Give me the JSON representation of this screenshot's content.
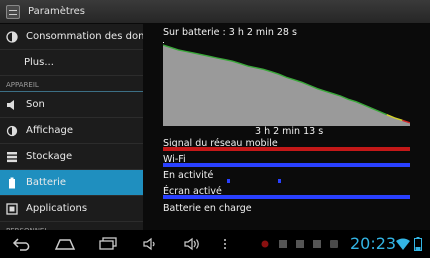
{
  "titlebar": {
    "title": "Paramètres"
  },
  "sidebar": {
    "items": [
      {
        "label": "Consommation des donné"
      },
      {
        "label": "Plus..."
      },
      {
        "section": "APPAREIL"
      },
      {
        "label": "Son"
      },
      {
        "label": "Affichage"
      },
      {
        "label": "Stockage"
      },
      {
        "label": "Batterie"
      },
      {
        "label": "Applications"
      },
      {
        "section": "PERSONNEL"
      }
    ]
  },
  "battery": {
    "summary": "Sur batterie : 3 h 2 min 28 s",
    "duration": "3 h 2 min 13 s",
    "level_history": [
      1.0,
      0.97,
      0.94,
      0.92,
      0.9,
      0.88,
      0.86,
      0.84,
      0.82,
      0.8,
      0.77,
      0.74,
      0.72,
      0.7,
      0.67,
      0.64,
      0.6,
      0.57,
      0.54,
      0.5,
      0.46,
      0.43,
      0.4,
      0.37,
      0.33,
      0.3,
      0.26,
      0.22,
      0.18,
      0.14,
      0.1,
      0.07,
      0.04
    ],
    "bars": [
      {
        "label": "Signal du réseau mobile",
        "color": "#c41818"
      },
      {
        "label": "Wi-Fi",
        "color": "#2940ff"
      },
      {
        "label": "En activité",
        "color": "#2940ff"
      },
      {
        "label": "Écran activé",
        "color": "#2940ff"
      },
      {
        "label": "Batterie en charge",
        "color": ""
      }
    ]
  },
  "statusbar": {
    "time": "20:23"
  },
  "colors": {
    "accent": "#1f8fbf",
    "clock": "#33b5e5",
    "graph_fill": "#9a9a9a",
    "graph_line": "#3aa83a"
  }
}
